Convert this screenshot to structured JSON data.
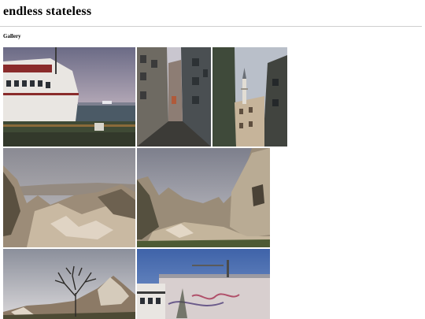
{
  "site": {
    "title": "endless stateless"
  },
  "gallery": {
    "heading": "Gallery",
    "photos": [
      {
        "subject": "white ferry boat docked at harbour under cloudy sky"
      },
      {
        "subject": "narrow cobbled alley between old buildings"
      },
      {
        "subject": "minaret between buildings looking up"
      },
      {
        "subject": "rocky cappadocia valley under grey sky"
      },
      {
        "subject": "fairy chimney rock formations and cliff"
      },
      {
        "subject": "bare tree in front of rocky landscape"
      },
      {
        "subject": "industrial building with graffiti wall under blue sky"
      }
    ]
  }
}
